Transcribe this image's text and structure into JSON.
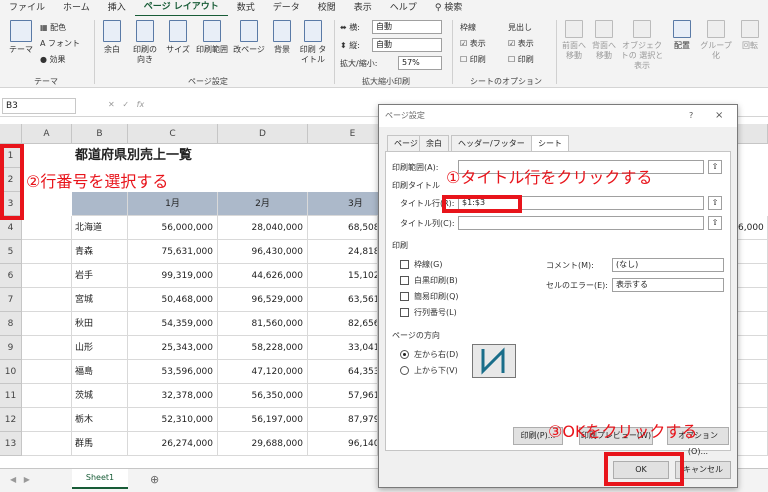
{
  "menu": [
    "ファイル",
    "ホーム",
    "挿入",
    "ページ レイアウト",
    "数式",
    "データ",
    "校閲",
    "表示",
    "ヘルプ",
    "検索"
  ],
  "ribbon": {
    "theme": [
      "テーマ",
      "配色",
      "フォント",
      "効果"
    ],
    "theme_group": "テーマ",
    "page_setup": [
      "余白",
      "印刷の\n向き",
      "サイズ",
      "印刷範囲",
      "改ページ",
      "背景",
      "印刷\nタイトル"
    ],
    "page_setup_group": "ページ設定",
    "scale": {
      "width_label": "横:",
      "width_val": "自動",
      "height_label": "縦:",
      "height_val": "自動",
      "zoom_label": "拡大/縮小:",
      "zoom_val": "57%"
    },
    "scale_group": "拡大縮小印刷",
    "sheet_opts": {
      "grid": "枠線",
      "heading": "見出し",
      "view": "表示",
      "print": "印刷"
    },
    "sheet_group": "シートのオプション",
    "arrange": [
      "前面へ\n移動",
      "背面へ\n移動",
      "オブジェクトの\n選択と表示",
      "配置",
      "グループ化",
      "回転"
    ]
  },
  "namebox": "B3",
  "columns": [
    "A",
    "B",
    "C",
    "D",
    "E"
  ],
  "title": "都道府県別売上一覧",
  "months": [
    "1月",
    "2月",
    "3月"
  ],
  "rows": [
    {
      "n": "4",
      "pref": "北海道",
      "v": [
        "56,000,000",
        "28,040,000",
        "68,508"
      ]
    },
    {
      "n": "5",
      "pref": "青森",
      "v": [
        "75,631,000",
        "96,430,000",
        "24,818"
      ]
    },
    {
      "n": "6",
      "pref": "岩手",
      "v": [
        "99,319,000",
        "44,626,000",
        "15,102"
      ]
    },
    {
      "n": "7",
      "pref": "宮城",
      "v": [
        "50,468,000",
        "96,529,000",
        "63,561"
      ]
    },
    {
      "n": "8",
      "pref": "秋田",
      "v": [
        "54,359,000",
        "81,560,000",
        "82,656"
      ]
    },
    {
      "n": "9",
      "pref": "山形",
      "v": [
        "25,343,000",
        "58,228,000",
        "33,041"
      ]
    },
    {
      "n": "10",
      "pref": "福島",
      "v": [
        "53,596,000",
        "47,120,000",
        "64,353"
      ]
    },
    {
      "n": "11",
      "pref": "茨城",
      "v": [
        "32,378,000",
        "56,350,000",
        "57,961"
      ]
    },
    {
      "n": "12",
      "pref": "栃木",
      "v": [
        "52,310,000",
        "56,197,000",
        "87,979"
      ]
    },
    {
      "n": "13",
      "pref": "群馬",
      "v": [
        "26,274,000",
        "29,688,000",
        "96,140"
      ]
    }
  ],
  "right_col": [
    "6,000",
    "",
    "",
    "",
    "",
    "",
    "",
    "",
    "",
    ""
  ],
  "sheet_tab": "Sheet1",
  "dialog": {
    "title": "ページ設定",
    "help": "?",
    "close": "×",
    "tabs": [
      "ページ",
      "余白",
      "ヘッダー/フッター",
      "シート"
    ],
    "print_area": "印刷範囲(A):",
    "print_titles": "印刷タイトル",
    "title_rows": "タイトル行(R):",
    "title_rows_val": "$1:$3",
    "title_cols": "タイトル列(C):",
    "print_section": "印刷",
    "gridlines": "枠線(G)",
    "bw": "白黒印刷(B)",
    "draft": "簡易印刷(Q)",
    "rowcol": "行列番号(L)",
    "comments_label": "コメント(M):",
    "comments_val": "(なし)",
    "errors_label": "セルのエラー(E):",
    "errors_val": "表示する",
    "order_section": "ページの方向",
    "down_then_over": "左から右(D)",
    "over_then_down": "上から下(V)",
    "print_btn": "印刷(P)...",
    "preview_btn": "印刷プレビュー(W)",
    "options_btn": "オプション(O)...",
    "ok": "OK",
    "cancel": "キャンセル"
  },
  "annotations": {
    "a1": "①タイトル行をクリックする",
    "a2": "②行番号を選択する",
    "a3": "③OKをクリックする"
  },
  "colors": {
    "accent": "#185c37",
    "header_fill": "#acb9ca",
    "annotation": "#e8141b"
  }
}
